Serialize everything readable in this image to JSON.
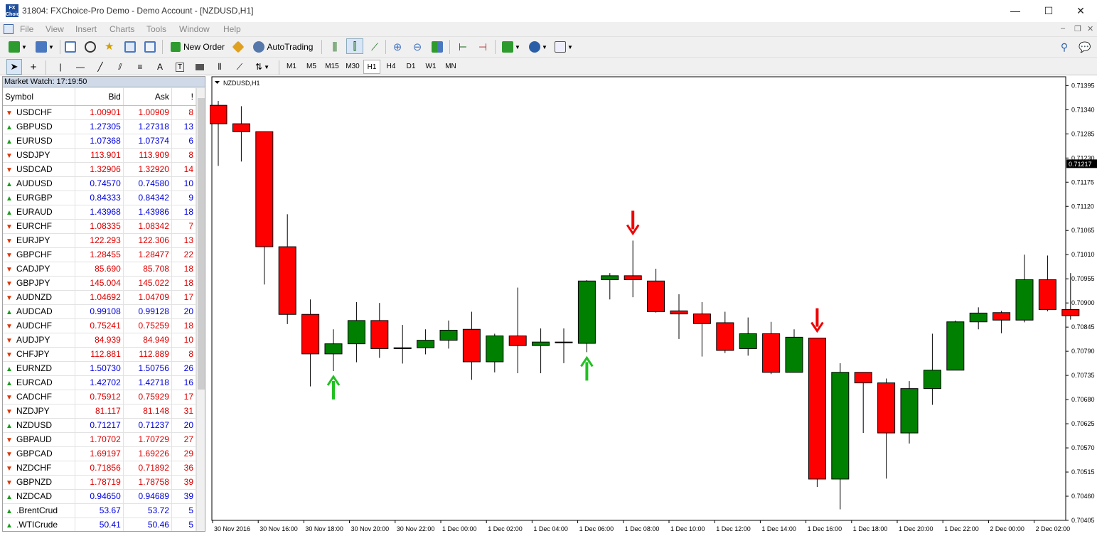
{
  "window": {
    "title": "31804: FXChoice-Pro Demo - Demo Account - [NZDUSD,H1]",
    "logo_text": "FX Choice",
    "minimize": "—",
    "maximize": "☐",
    "close": "✕"
  },
  "menu": [
    "File",
    "View",
    "Insert",
    "Charts",
    "Tools",
    "Window",
    "Help"
  ],
  "toolbar": {
    "new_order": "New Order",
    "autotrading": "AutoTrading"
  },
  "timeframes": [
    "M1",
    "M5",
    "M15",
    "M30",
    "H1",
    "H4",
    "D1",
    "W1",
    "MN"
  ],
  "active_timeframe": "H1",
  "market_watch": {
    "title": "Market Watch: 17:19:50",
    "columns": {
      "symbol": "Symbol",
      "bid": "Bid",
      "ask": "Ask",
      "spread": "!"
    },
    "rows": [
      {
        "symbol": "USDCHF",
        "bid": "1.00901",
        "ask": "1.00909",
        "spread": "8",
        "dir": "down"
      },
      {
        "symbol": "GBPUSD",
        "bid": "1.27305",
        "ask": "1.27318",
        "spread": "13",
        "dir": "up"
      },
      {
        "symbol": "EURUSD",
        "bid": "1.07368",
        "ask": "1.07374",
        "spread": "6",
        "dir": "up"
      },
      {
        "symbol": "USDJPY",
        "bid": "113.901",
        "ask": "113.909",
        "spread": "8",
        "dir": "down"
      },
      {
        "symbol": "USDCAD",
        "bid": "1.32906",
        "ask": "1.32920",
        "spread": "14",
        "dir": "down"
      },
      {
        "symbol": "AUDUSD",
        "bid": "0.74570",
        "ask": "0.74580",
        "spread": "10",
        "dir": "up"
      },
      {
        "symbol": "EURGBP",
        "bid": "0.84333",
        "ask": "0.84342",
        "spread": "9",
        "dir": "up"
      },
      {
        "symbol": "EURAUD",
        "bid": "1.43968",
        "ask": "1.43986",
        "spread": "18",
        "dir": "up"
      },
      {
        "symbol": "EURCHF",
        "bid": "1.08335",
        "ask": "1.08342",
        "spread": "7",
        "dir": "down"
      },
      {
        "symbol": "EURJPY",
        "bid": "122.293",
        "ask": "122.306",
        "spread": "13",
        "dir": "down"
      },
      {
        "symbol": "GBPCHF",
        "bid": "1.28455",
        "ask": "1.28477",
        "spread": "22",
        "dir": "down"
      },
      {
        "symbol": "CADJPY",
        "bid": "85.690",
        "ask": "85.708",
        "spread": "18",
        "dir": "down"
      },
      {
        "symbol": "GBPJPY",
        "bid": "145.004",
        "ask": "145.022",
        "spread": "18",
        "dir": "down"
      },
      {
        "symbol": "AUDNZD",
        "bid": "1.04692",
        "ask": "1.04709",
        "spread": "17",
        "dir": "down"
      },
      {
        "symbol": "AUDCAD",
        "bid": "0.99108",
        "ask": "0.99128",
        "spread": "20",
        "dir": "up"
      },
      {
        "symbol": "AUDCHF",
        "bid": "0.75241",
        "ask": "0.75259",
        "spread": "18",
        "dir": "down"
      },
      {
        "symbol": "AUDJPY",
        "bid": "84.939",
        "ask": "84.949",
        "spread": "10",
        "dir": "down"
      },
      {
        "symbol": "CHFJPY",
        "bid": "112.881",
        "ask": "112.889",
        "spread": "8",
        "dir": "down"
      },
      {
        "symbol": "EURNZD",
        "bid": "1.50730",
        "ask": "1.50756",
        "spread": "26",
        "dir": "up"
      },
      {
        "symbol": "EURCAD",
        "bid": "1.42702",
        "ask": "1.42718",
        "spread": "16",
        "dir": "up"
      },
      {
        "symbol": "CADCHF",
        "bid": "0.75912",
        "ask": "0.75929",
        "spread": "17",
        "dir": "down"
      },
      {
        "symbol": "NZDJPY",
        "bid": "81.117",
        "ask": "81.148",
        "spread": "31",
        "dir": "down"
      },
      {
        "symbol": "NZDUSD",
        "bid": "0.71217",
        "ask": "0.71237",
        "spread": "20",
        "dir": "up"
      },
      {
        "symbol": "GBPAUD",
        "bid": "1.70702",
        "ask": "1.70729",
        "spread": "27",
        "dir": "down"
      },
      {
        "symbol": "GBPCAD",
        "bid": "1.69197",
        "ask": "1.69226",
        "spread": "29",
        "dir": "down"
      },
      {
        "symbol": "NZDCHF",
        "bid": "0.71856",
        "ask": "0.71892",
        "spread": "36",
        "dir": "down"
      },
      {
        "symbol": "GBPNZD",
        "bid": "1.78719",
        "ask": "1.78758",
        "spread": "39",
        "dir": "down"
      },
      {
        "symbol": "NZDCAD",
        "bid": "0.94650",
        "ask": "0.94689",
        "spread": "39",
        "dir": "up"
      },
      {
        "symbol": ".BrentCrud",
        "bid": "53.67",
        "ask": "53.72",
        "spread": "5",
        "dir": "up"
      },
      {
        "symbol": ".WTICrude",
        "bid": "50.41",
        "ask": "50.46",
        "spread": "5",
        "dir": "up"
      }
    ]
  },
  "colors": {
    "up_text": "#0000dd",
    "down_text": "#dd0000",
    "up_arrow": "#1a9a1a",
    "down_arrow": "#dd3300",
    "bull": "#008000",
    "bear": "#ff0000",
    "signal_up": "#22c022",
    "signal_down": "#ee0000",
    "price_marker_bg": "#000000"
  },
  "chart_data": {
    "type": "candlestick",
    "title": "NZDUSD,H1",
    "ylim": [
      0.70405,
      0.71415
    ],
    "y_ticks": [
      "0.71395",
      "0.71340",
      "0.71285",
      "0.71230",
      "0.71175",
      "0.71120",
      "0.71065",
      "0.71010",
      "0.70955",
      "0.70900",
      "0.70845",
      "0.70790",
      "0.70735",
      "0.70680",
      "0.70625",
      "0.70570",
      "0.70515",
      "0.70460",
      "0.70405"
    ],
    "current_price": "0.71217",
    "x_labels": [
      "30 Nov 2016",
      "30 Nov 16:00",
      "30 Nov 18:00",
      "30 Nov 20:00",
      "30 Nov 22:00",
      "1 Dec 00:00",
      "1 Dec 02:00",
      "1 Dec 04:00",
      "1 Dec 06:00",
      "1 Dec 08:00",
      "1 Dec 10:00",
      "1 Dec 12:00",
      "1 Dec 14:00",
      "1 Dec 16:00",
      "1 Dec 18:00",
      "1 Dec 20:00",
      "1 Dec 22:00",
      "2 Dec 00:00",
      "2 Dec 02:00"
    ],
    "candles": [
      {
        "o": 0.7135,
        "h": 0.7136,
        "l": 0.71212,
        "c": 0.71308
      },
      {
        "o": 0.71308,
        "h": 0.71348,
        "l": 0.71222,
        "c": 0.7129
      },
      {
        "o": 0.7129,
        "h": 0.7129,
        "l": 0.70942,
        "c": 0.71028
      },
      {
        "o": 0.71028,
        "h": 0.71102,
        "l": 0.70852,
        "c": 0.70874
      },
      {
        "o": 0.70874,
        "h": 0.70908,
        "l": 0.7071,
        "c": 0.70784
      },
      {
        "o": 0.70784,
        "h": 0.7084,
        "l": 0.70745,
        "c": 0.70807
      },
      {
        "o": 0.70807,
        "h": 0.70902,
        "l": 0.70765,
        "c": 0.7086
      },
      {
        "o": 0.7086,
        "h": 0.709,
        "l": 0.70775,
        "c": 0.70796
      },
      {
        "o": 0.70796,
        "h": 0.7085,
        "l": 0.70762,
        "c": 0.70798
      },
      {
        "o": 0.70798,
        "h": 0.7084,
        "l": 0.70783,
        "c": 0.70815
      },
      {
        "o": 0.70815,
        "h": 0.7086,
        "l": 0.70796,
        "c": 0.70838
      },
      {
        "o": 0.7084,
        "h": 0.7088,
        "l": 0.70725,
        "c": 0.70766
      },
      {
        "o": 0.70766,
        "h": 0.7083,
        "l": 0.70742,
        "c": 0.70825
      },
      {
        "o": 0.70825,
        "h": 0.70935,
        "l": 0.7074,
        "c": 0.70803
      },
      {
        "o": 0.70803,
        "h": 0.70842,
        "l": 0.7074,
        "c": 0.70811
      },
      {
        "o": 0.70811,
        "h": 0.70842,
        "l": 0.70763,
        "c": 0.7081
      },
      {
        "o": 0.70808,
        "h": 0.70952,
        "l": 0.70788,
        "c": 0.7095
      },
      {
        "o": 0.70953,
        "h": 0.70968,
        "l": 0.70908,
        "c": 0.70962
      },
      {
        "o": 0.70962,
        "h": 0.71042,
        "l": 0.70913,
        "c": 0.70953
      },
      {
        "o": 0.7095,
        "h": 0.70978,
        "l": 0.70878,
        "c": 0.7088
      },
      {
        "o": 0.70882,
        "h": 0.7092,
        "l": 0.70818,
        "c": 0.70875
      },
      {
        "o": 0.70875,
        "h": 0.70902,
        "l": 0.70778,
        "c": 0.70853
      },
      {
        "o": 0.70855,
        "h": 0.7088,
        "l": 0.70786,
        "c": 0.70792
      },
      {
        "o": 0.70796,
        "h": 0.70867,
        "l": 0.7078,
        "c": 0.7083
      },
      {
        "o": 0.7083,
        "h": 0.70857,
        "l": 0.70738,
        "c": 0.70742
      },
      {
        "o": 0.70742,
        "h": 0.7084,
        "l": 0.70742,
        "c": 0.70822
      },
      {
        "o": 0.7082,
        "h": 0.7082,
        "l": 0.70481,
        "c": 0.70499
      },
      {
        "o": 0.70499,
        "h": 0.70763,
        "l": 0.7043,
        "c": 0.70742
      },
      {
        "o": 0.70742,
        "h": 0.70742,
        "l": 0.70604,
        "c": 0.70718
      },
      {
        "o": 0.70718,
        "h": 0.70728,
        "l": 0.705,
        "c": 0.70604
      },
      {
        "o": 0.70604,
        "h": 0.70722,
        "l": 0.7058,
        "c": 0.70705
      },
      {
        "o": 0.70705,
        "h": 0.7083,
        "l": 0.70668,
        "c": 0.70747
      },
      {
        "o": 0.70747,
        "h": 0.7086,
        "l": 0.70748,
        "c": 0.70857
      },
      {
        "o": 0.70857,
        "h": 0.7089,
        "l": 0.7084,
        "c": 0.70877
      },
      {
        "o": 0.70878,
        "h": 0.70882,
        "l": 0.70831,
        "c": 0.70861
      },
      {
        "o": 0.70861,
        "h": 0.7101,
        "l": 0.70856,
        "c": 0.70953
      },
      {
        "o": 0.70953,
        "h": 0.71008,
        "l": 0.70881,
        "c": 0.70885
      },
      {
        "o": 0.70885,
        "h": 0.70968,
        "l": 0.70862,
        "c": 0.70871
      }
    ],
    "signals": [
      {
        "candle": 5,
        "dir": "up"
      },
      {
        "candle": 16,
        "dir": "up"
      },
      {
        "candle": 18,
        "dir": "down"
      },
      {
        "candle": 26,
        "dir": "down"
      }
    ]
  }
}
